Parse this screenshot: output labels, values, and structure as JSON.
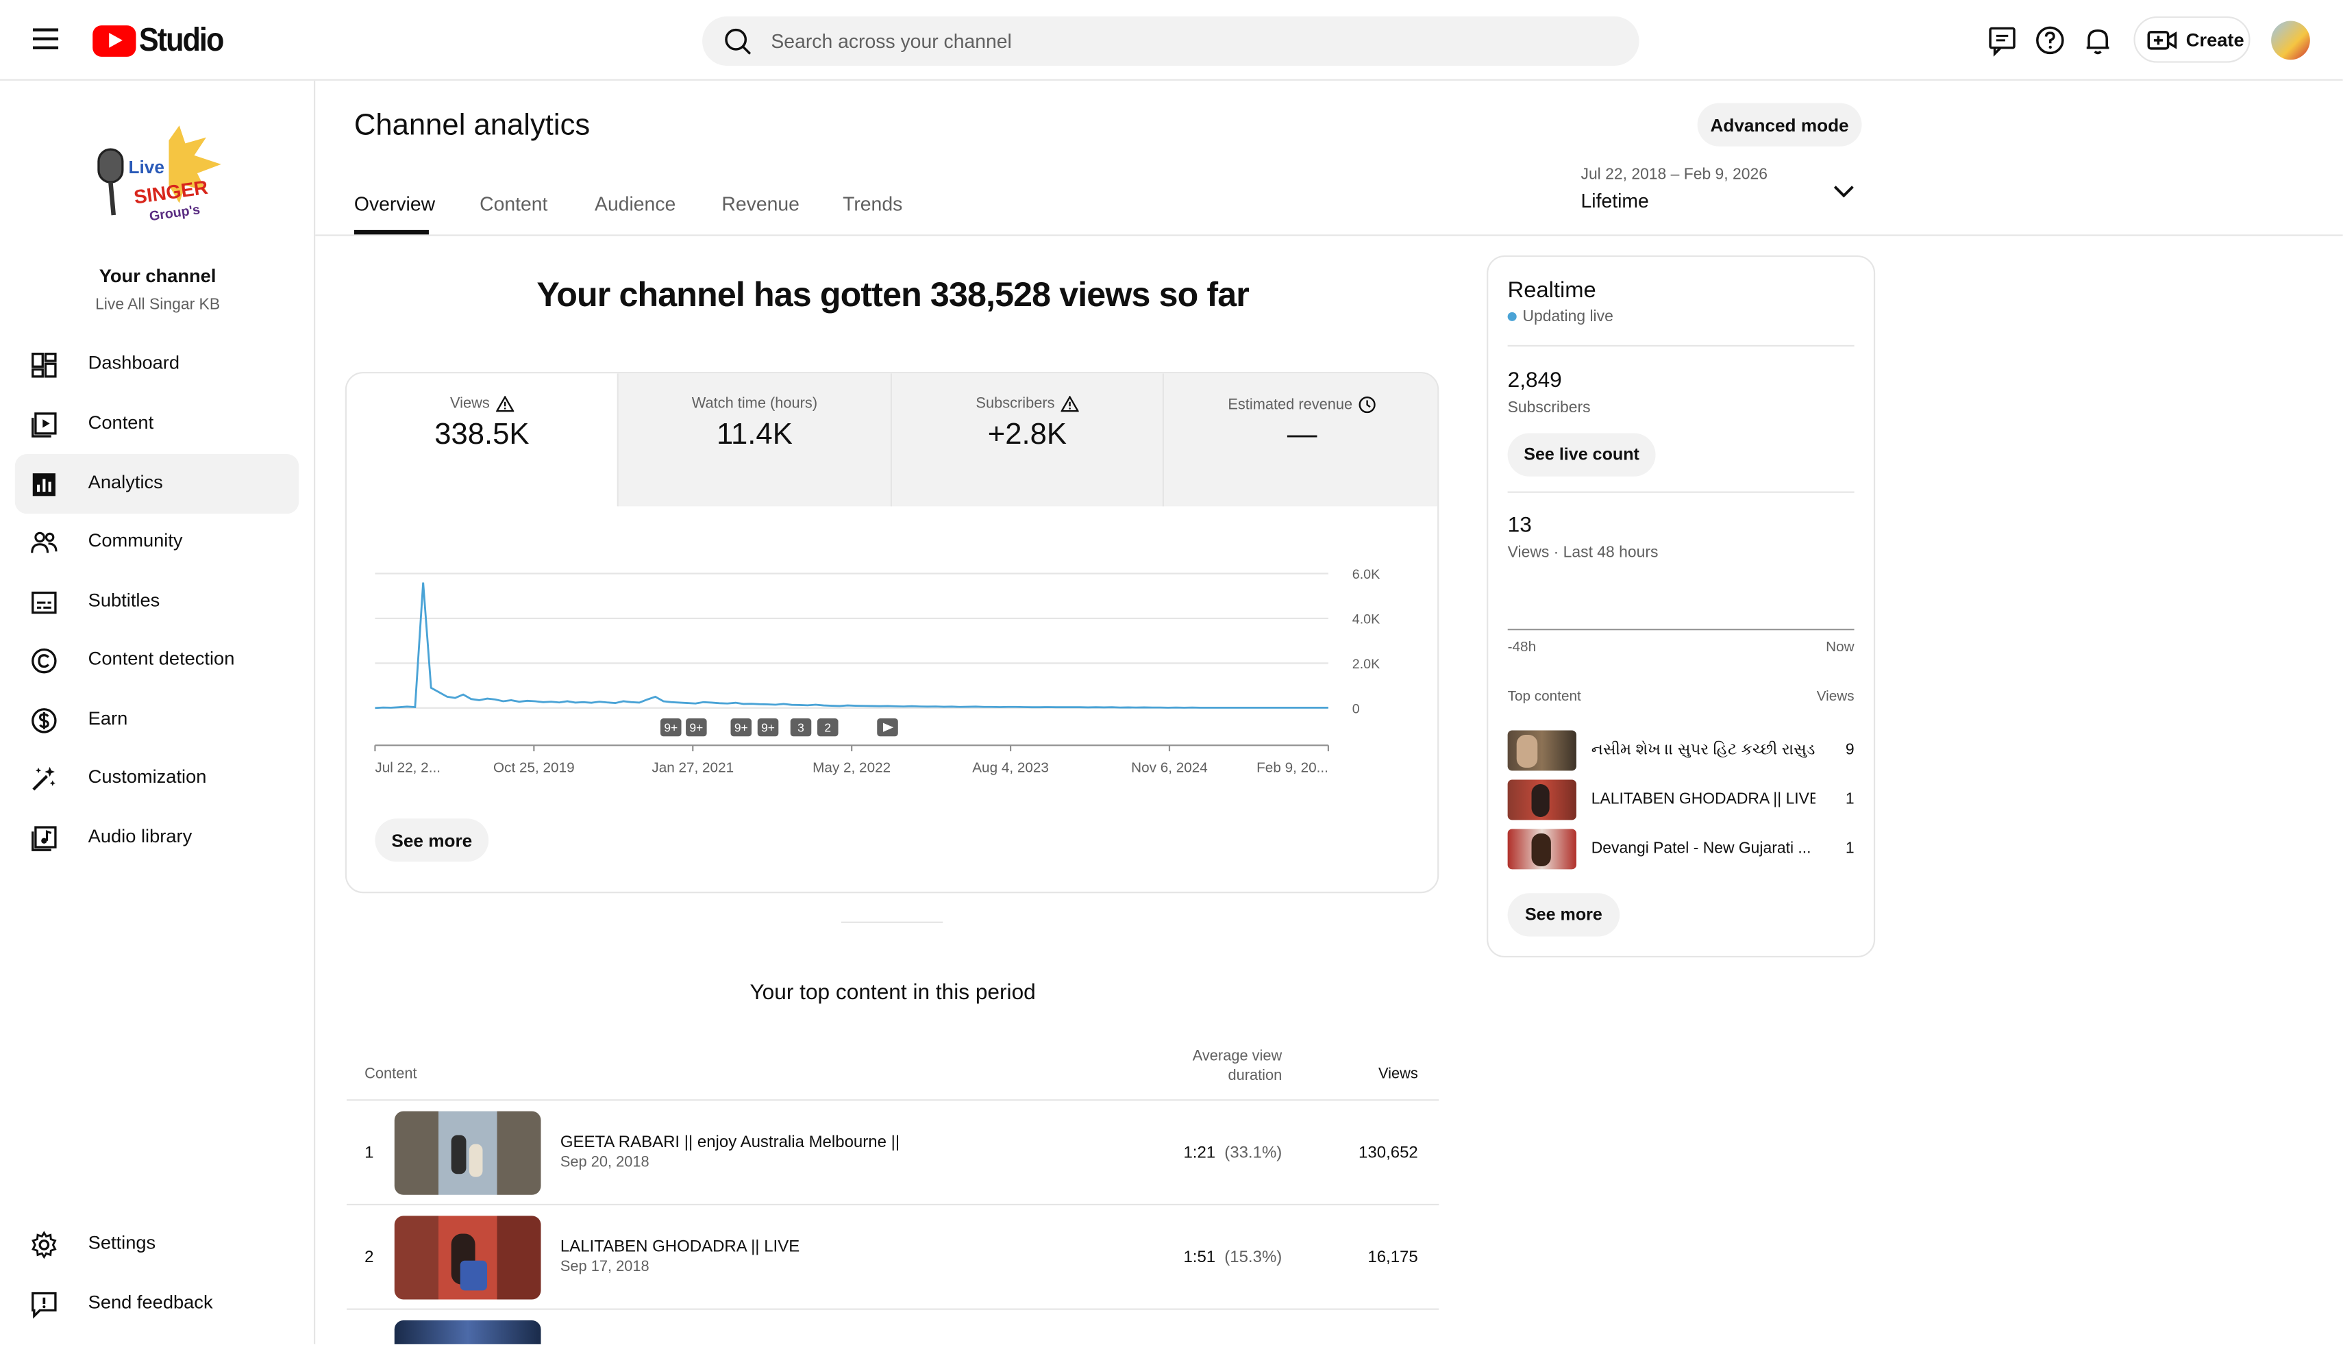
{
  "header": {
    "logo_text": "Studio",
    "search_placeholder": "Search across your channel",
    "create_label": "Create"
  },
  "sidebar": {
    "channel_label": "Your channel",
    "channel_name": "Live All Singar KB",
    "logo_text": [
      "Live",
      "SINGER",
      "Group's"
    ],
    "items": [
      {
        "label": "Dashboard",
        "icon": "dashboard-icon"
      },
      {
        "label": "Content",
        "icon": "content-icon"
      },
      {
        "label": "Analytics",
        "icon": "analytics-icon",
        "active": true
      },
      {
        "label": "Community",
        "icon": "community-icon"
      },
      {
        "label": "Subtitles",
        "icon": "subtitles-icon"
      },
      {
        "label": "Content detection",
        "icon": "copyright-icon"
      },
      {
        "label": "Earn",
        "icon": "dollar-icon"
      },
      {
        "label": "Customization",
        "icon": "magic-wand-icon"
      },
      {
        "label": "Audio library",
        "icon": "audio-library-icon"
      }
    ],
    "bottom": [
      {
        "label": "Settings",
        "icon": "gear-icon"
      },
      {
        "label": "Send feedback",
        "icon": "feedback-icon"
      }
    ]
  },
  "main": {
    "title": "Channel analytics",
    "advanced_label": "Advanced mode",
    "tabs": [
      "Overview",
      "Content",
      "Audience",
      "Revenue",
      "Trends"
    ],
    "date_range": "Jul 22, 2018 – Feb 9, 2026",
    "date_value": "Lifetime",
    "headline": "Your channel has gotten 338,528 views so far",
    "metrics": [
      {
        "label": "Views",
        "value": "338.5K",
        "icon": "warning-icon"
      },
      {
        "label": "Watch time (hours)",
        "value": "11.4K"
      },
      {
        "label": "Subscribers",
        "value": "+2.8K",
        "icon": "warning-icon"
      },
      {
        "label": "Estimated revenue",
        "value": "—",
        "icon": "clock-icon"
      }
    ],
    "see_more": "See more",
    "markers": [
      "9+",
      "9+",
      "9+",
      "9+",
      "3",
      "2"
    ],
    "top_content": {
      "title": "Your top content in this period",
      "col_content": "Content",
      "col_avd": [
        "Average view",
        "duration"
      ],
      "col_views": "Views",
      "rows": [
        {
          "rank": "1",
          "title": "GEETA RABARI || enjoy Australia Melbourne ||",
          "date": "Sep 20, 2018",
          "duration": "1:21",
          "pct": "(33.1%)",
          "views": "130,652"
        },
        {
          "rank": "2",
          "title": "LALITABEN GHODADRA || LIVE",
          "date": "Sep 17, 2018",
          "duration": "1:51",
          "pct": "(15.3%)",
          "views": "16,175"
        }
      ]
    }
  },
  "chart_data": {
    "type": "line",
    "series": [
      {
        "values": [
          0,
          20,
          10,
          30,
          60,
          40,
          5600,
          900,
          700,
          500,
          450,
          600,
          400,
          350,
          420,
          380,
          300,
          350,
          280,
          320,
          300,
          260,
          280,
          250,
          300,
          240,
          260,
          230,
          280,
          250,
          220,
          300,
          260,
          240,
          380,
          500,
          300,
          260,
          240,
          220,
          200,
          260,
          240,
          210,
          200,
          230,
          180,
          190,
          170,
          160,
          150,
          180,
          140,
          130,
          120,
          150,
          110,
          100,
          90,
          110,
          100,
          95,
          90,
          80,
          85,
          75,
          70,
          80,
          65,
          60,
          70,
          55,
          60,
          50,
          55,
          60,
          45,
          50,
          40,
          45,
          50,
          40,
          35,
          30,
          40,
          35,
          30,
          35,
          30,
          25,
          30,
          25,
          30,
          20,
          25,
          20,
          25,
          20,
          20,
          15,
          20,
          15,
          20,
          15,
          15,
          10,
          15,
          10,
          15,
          10,
          10,
          10,
          10,
          10,
          10,
          10,
          10,
          10,
          10,
          10
        ]
      }
    ],
    "xlabels": [
      "Jul 22, 2...",
      "Oct 25, 2019",
      "Jan 27, 2021",
      "May 2, 2022",
      "Aug 4, 2023",
      "Nov 6, 2024",
      "Feb 9, 20..."
    ],
    "yticks": [
      "6.0K",
      "4.0K",
      "2.0K",
      "0"
    ],
    "ylim": [
      0,
      6000
    ],
    "grid": true
  },
  "realtime": {
    "title": "Realtime",
    "status": "Updating live",
    "subscribers": "2,849",
    "subscribers_label": "Subscribers",
    "live_count_label": "See live count",
    "views": "13",
    "views_label": "Views · Last 48 hours",
    "axis_left": "-48h",
    "axis_right": "Now",
    "bars": [
      0,
      0,
      0,
      0,
      0,
      0,
      0,
      0,
      0,
      0,
      0,
      0,
      0,
      0,
      0,
      0,
      0,
      0,
      0,
      0,
      0,
      0,
      0,
      0,
      0,
      0,
      0,
      0,
      0,
      0,
      0,
      0,
      0,
      0,
      0,
      0,
      0,
      0,
      0,
      0,
      0,
      0,
      0,
      0,
      0,
      0,
      0,
      0,
      0,
      0,
      0,
      0,
      0,
      0,
      0,
      0,
      0,
      0,
      0,
      0,
      0,
      0,
      0,
      0,
      0,
      0,
      0,
      0,
      0,
      0,
      0,
      0,
      0,
      0,
      0,
      0,
      0,
      0,
      0,
      0,
      0,
      0,
      0,
      0,
      0,
      0,
      0,
      0,
      0,
      0,
      0,
      0,
      0,
      0,
      0,
      0,
      0,
      0,
      0,
      0
    ],
    "top_content_label": "Top content",
    "views_col": "Views",
    "items": [
      {
        "title": "નસીમ શેખ ।। સુપર હિટ કચ્છી રાસુડા",
        "views": "9"
      },
      {
        "title": "LALITABEN GHODADRA || LIVE",
        "views": "1"
      },
      {
        "title": "Devangi Patel - New Gujarati ...",
        "views": "1"
      }
    ],
    "see_more": "See more"
  }
}
